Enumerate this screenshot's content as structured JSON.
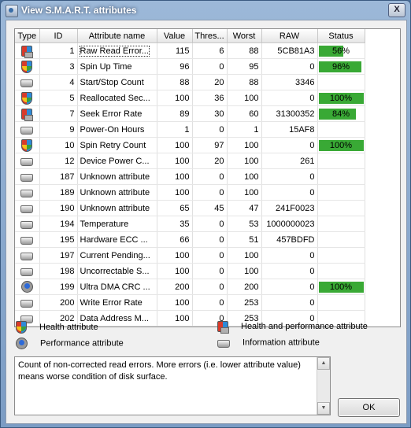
{
  "window": {
    "title": "View S.M.A.R.T. attributes",
    "close_glyph": "X"
  },
  "table": {
    "columns": [
      "Type",
      "ID",
      "Attribute name",
      "Value",
      "Thres...",
      "Worst",
      "RAW",
      "Status"
    ],
    "rows": [
      {
        "type": "health-performance",
        "id": "1",
        "name": "Raw Read Error...",
        "value": "115",
        "thres": "6",
        "worst": "88",
        "raw": "5CB81A3",
        "status": "56%",
        "status_fraction": 0.56
      },
      {
        "type": "health",
        "id": "3",
        "name": "Spin Up Time",
        "value": "96",
        "thres": "0",
        "worst": "95",
        "raw": "0",
        "status": "96%",
        "status_fraction": 0.96
      },
      {
        "type": "information",
        "id": "4",
        "name": "Start/Stop Count",
        "value": "88",
        "thres": "20",
        "worst": "88",
        "raw": "3346",
        "status": "",
        "status_fraction": null
      },
      {
        "type": "health",
        "id": "5",
        "name": "Reallocated Sec...",
        "value": "100",
        "thres": "36",
        "worst": "100",
        "raw": "0",
        "status": "100%",
        "status_fraction": 1.0
      },
      {
        "type": "health-performance",
        "id": "7",
        "name": "Seek Error Rate",
        "value": "89",
        "thres": "30",
        "worst": "60",
        "raw": "31300352",
        "status": "84%",
        "status_fraction": 0.84
      },
      {
        "type": "information",
        "id": "9",
        "name": "Power-On Hours",
        "value": "1",
        "thres": "0",
        "worst": "1",
        "raw": "15AF8",
        "status": "",
        "status_fraction": null
      },
      {
        "type": "health",
        "id": "10",
        "name": "Spin Retry Count",
        "value": "100",
        "thres": "97",
        "worst": "100",
        "raw": "0",
        "status": "100%",
        "status_fraction": 1.0
      },
      {
        "type": "information",
        "id": "12",
        "name": "Device Power C...",
        "value": "100",
        "thres": "20",
        "worst": "100",
        "raw": "261",
        "status": "",
        "status_fraction": null
      },
      {
        "type": "information",
        "id": "187",
        "name": "Unknown attribute",
        "value": "100",
        "thres": "0",
        "worst": "100",
        "raw": "0",
        "status": "",
        "status_fraction": null
      },
      {
        "type": "information",
        "id": "189",
        "name": "Unknown attribute",
        "value": "100",
        "thres": "0",
        "worst": "100",
        "raw": "0",
        "status": "",
        "status_fraction": null
      },
      {
        "type": "information",
        "id": "190",
        "name": "Unknown attribute",
        "value": "65",
        "thres": "45",
        "worst": "47",
        "raw": "241F0023",
        "status": "",
        "status_fraction": null
      },
      {
        "type": "information",
        "id": "194",
        "name": "Temperature",
        "value": "35",
        "thres": "0",
        "worst": "53",
        "raw": "1000000023",
        "status": "",
        "status_fraction": null
      },
      {
        "type": "information",
        "id": "195",
        "name": "Hardware ECC ...",
        "value": "66",
        "thres": "0",
        "worst": "51",
        "raw": "457BDFD",
        "status": "",
        "status_fraction": null
      },
      {
        "type": "information",
        "id": "197",
        "name": "Current Pending...",
        "value": "100",
        "thres": "0",
        "worst": "100",
        "raw": "0",
        "status": "",
        "status_fraction": null
      },
      {
        "type": "information",
        "id": "198",
        "name": "Uncorrectable S...",
        "value": "100",
        "thres": "0",
        "worst": "100",
        "raw": "0",
        "status": "",
        "status_fraction": null
      },
      {
        "type": "performance",
        "id": "199",
        "name": "Ultra DMA CRC ...",
        "value": "200",
        "thres": "0",
        "worst": "200",
        "raw": "0",
        "status": "100%",
        "status_fraction": 1.0
      },
      {
        "type": "information",
        "id": "200",
        "name": "Write Error Rate",
        "value": "100",
        "thres": "0",
        "worst": "253",
        "raw": "0",
        "status": "",
        "status_fraction": null
      },
      {
        "type": "information",
        "id": "202",
        "name": "Data Address M...",
        "value": "100",
        "thres": "0",
        "worst": "253",
        "raw": "0",
        "status": "",
        "status_fraction": null
      }
    ],
    "selected_row": 0
  },
  "legend": {
    "health": "Health attribute",
    "health_performance": "Health and performance attribute",
    "performance": "Performance attribute",
    "information": "Information attribute"
  },
  "description": "Count of non-corrected read errors. More errors (i.e. lower attribute value) means worse condition of disk surface.",
  "buttons": {
    "ok": "OK"
  },
  "colors": {
    "status_bar": "#39a935",
    "title_bar": "#7b9cc4"
  }
}
